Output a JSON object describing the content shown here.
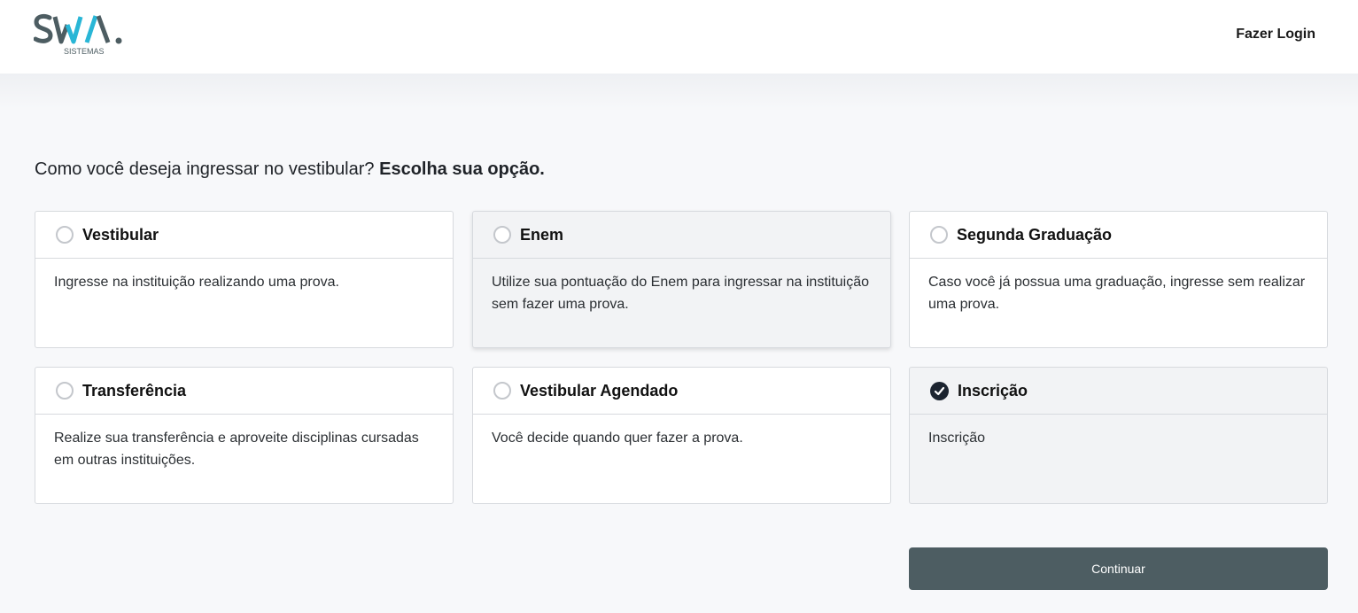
{
  "header": {
    "logo_text": "SWA.",
    "logo_subtext": "SISTEMAS",
    "login_label": "Fazer Login"
  },
  "question": {
    "prefix": "Como você deseja ingressar no vestibular?",
    "emphasis": "Escolha sua opção."
  },
  "options": [
    {
      "title": "Vestibular",
      "description": "Ingresse na instituição realizando uma prova.",
      "selected": false
    },
    {
      "title": "Enem",
      "description": "Utilize sua pontuação do Enem para ingressar na instituição sem fazer uma prova.",
      "selected": false
    },
    {
      "title": "Segunda Graduação",
      "description": "Caso você já possua uma graduação, ingresse sem realizar uma prova.",
      "selected": false
    },
    {
      "title": "Transferência",
      "description": "Realize sua transferência e aproveite disciplinas cursadas em outras instituições.",
      "selected": false
    },
    {
      "title": "Vestibular Agendado",
      "description": "Você decide quando quer fazer a prova.",
      "selected": false
    },
    {
      "title": "Inscrição",
      "description": "Inscrição",
      "selected": true
    }
  ],
  "continue_label": "Continuar",
  "colors": {
    "brand_dark": "#4d5d62",
    "brand_accent": "#29b6d6",
    "selected_check": "#1c2430"
  }
}
